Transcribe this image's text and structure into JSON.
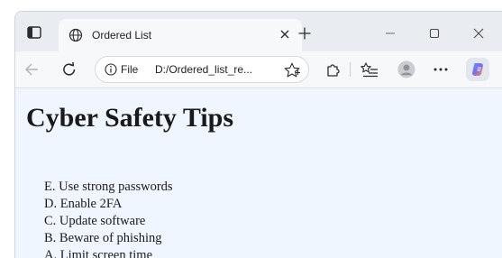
{
  "tab": {
    "title": "Ordered List",
    "close_icon": "close-icon"
  },
  "toolbar": {
    "file_label": "File",
    "url": "D:/Ordered_list_re..."
  },
  "page": {
    "heading": "Cyber Safety Tips",
    "list": [
      {
        "marker": "E.",
        "text": "Use strong passwords"
      },
      {
        "marker": "D.",
        "text": "Enable 2FA"
      },
      {
        "marker": "C.",
        "text": "Update software"
      },
      {
        "marker": "B.",
        "text": "Beware of phishing"
      },
      {
        "marker": "A.",
        "text": "Limit screen time"
      }
    ]
  },
  "colors": {
    "page_background": "#f0f6ff",
    "copilot_accent": "#8a63f2"
  }
}
